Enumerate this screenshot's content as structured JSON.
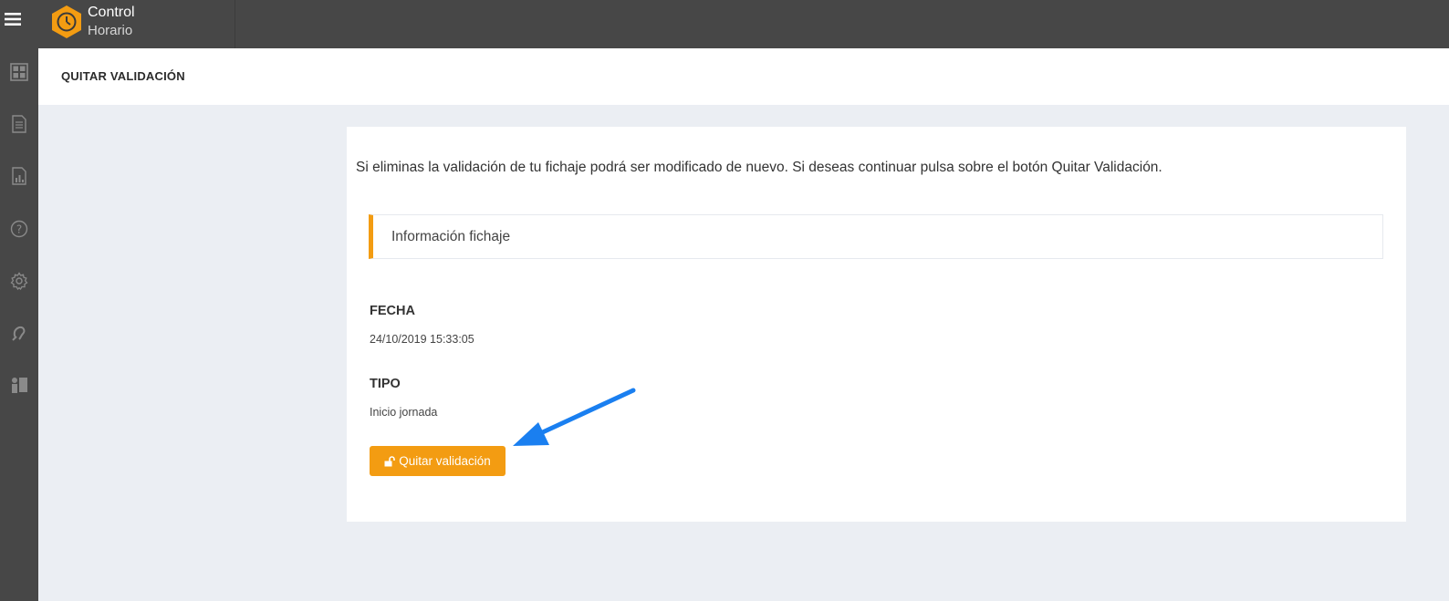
{
  "app": {
    "brand_line1": "Control",
    "brand_line2": "Horario",
    "accent_color": "#f39c12",
    "topbar_color": "#474747"
  },
  "sidebar": {
    "items": [
      {
        "icon": "menu-icon"
      },
      {
        "icon": "dashboard-icon"
      },
      {
        "icon": "document-icon"
      },
      {
        "icon": "report-icon"
      },
      {
        "icon": "help-icon"
      },
      {
        "icon": "gear-icon"
      },
      {
        "icon": "ear-icon"
      },
      {
        "icon": "users-icon"
      }
    ]
  },
  "header": {
    "title": "QUITAR VALIDACIÓN"
  },
  "main": {
    "intro": "Si eliminas la validación de tu fichaje podrá ser modificado de nuevo. Si deseas continuar pulsa sobre el botón Quitar Validación.",
    "info_title": "Información fichaje",
    "fields": [
      {
        "label": "FECHA",
        "value": "24/10/2019 15:33:05"
      },
      {
        "label": "TIPO",
        "value": "Inicio jornada"
      }
    ],
    "button_label": "Quitar validación",
    "button_icon": "unlock-icon"
  },
  "annotation": {
    "arrow_color": "#1a7ff0"
  }
}
